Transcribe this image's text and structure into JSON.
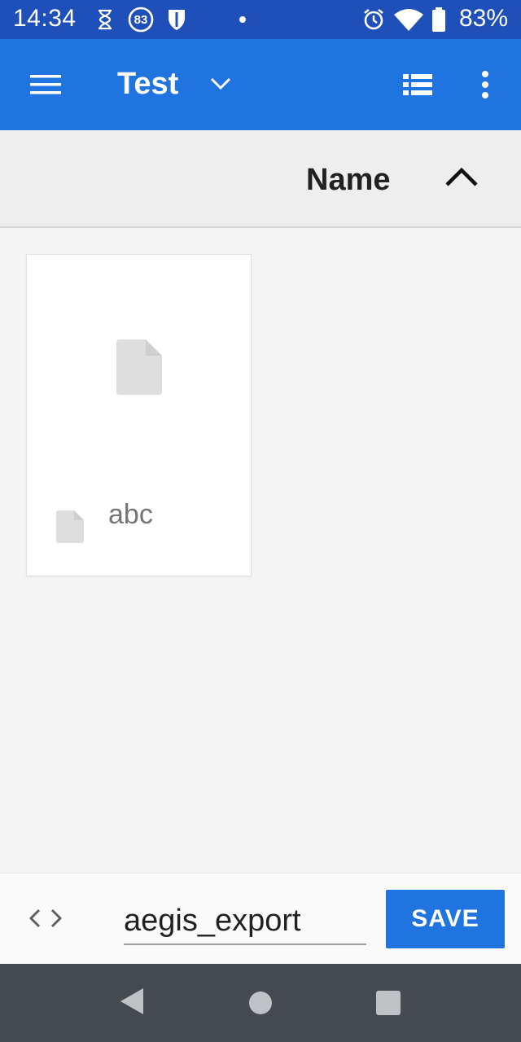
{
  "status_bar": {
    "time": "14:34",
    "badge_count": "83",
    "battery_percent": "83%",
    "icons": [
      "hourglass-icon",
      "badge-83-icon",
      "shield-icon",
      "dot-icon",
      "alarm-icon",
      "wifi-icon",
      "battery-icon"
    ]
  },
  "app_bar": {
    "title": "Test",
    "icons": [
      "menu-icon",
      "chevron-down-icon",
      "list-view-icon",
      "more-vert-icon"
    ],
    "color": "#1f74e0"
  },
  "sort_bar": {
    "label": "Name",
    "direction_icon": "chevron-up-icon"
  },
  "files": [
    {
      "name": "abc",
      "type_icon": "file-icon"
    }
  ],
  "bottom_bar": {
    "filename_value": "aegis_export",
    "save_label": "SAVE",
    "code_icon": "code-icon"
  },
  "nav_bar": {
    "icons": [
      "back-icon",
      "home-icon",
      "recents-icon"
    ]
  }
}
